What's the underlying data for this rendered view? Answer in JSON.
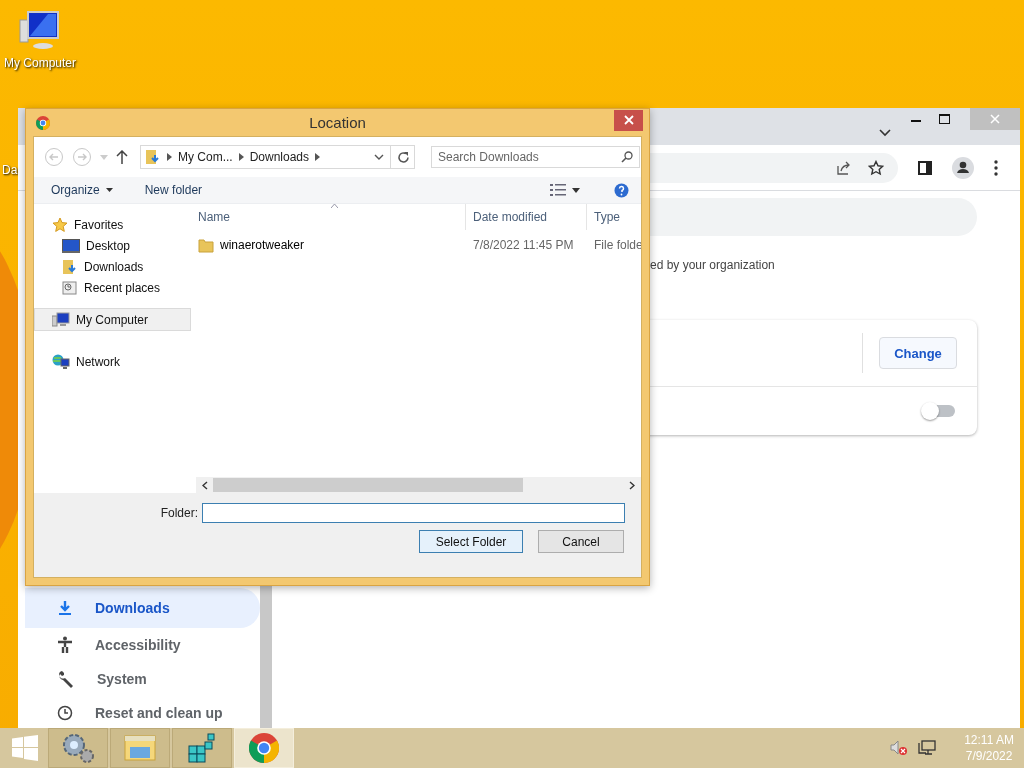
{
  "desktop": {
    "icon_label": "My Computer",
    "cut_label": "Da"
  },
  "browser": {
    "nav": [
      {
        "label": "Downloads",
        "kind": "download",
        "selected": true
      },
      {
        "label": "Accessibility",
        "kind": "accessibility",
        "selected": false
      },
      {
        "label": "System",
        "kind": "wrench",
        "selected": false
      },
      {
        "label": "Reset and clean up",
        "kind": "reset",
        "selected": false
      }
    ],
    "notice": "ed by your organization",
    "change_button": "Change",
    "toggle": {
      "on": false
    }
  },
  "dialog": {
    "title": "Location",
    "breadcrumb": [
      "My Com...",
      "Downloads"
    ],
    "search": {
      "placeholder": "Search Downloads"
    },
    "organize": "Organize",
    "new_folder": "New folder",
    "nav": [
      {
        "label": "Favorites",
        "kind": "star",
        "selected": false,
        "children": [
          {
            "label": "Desktop",
            "kind": "desktop",
            "selected": false
          },
          {
            "label": "Downloads",
            "kind": "downloads",
            "selected": false
          },
          {
            "label": "Recent places",
            "kind": "recent",
            "selected": false
          }
        ]
      },
      {
        "label": "My Computer",
        "kind": "computer",
        "selected": true
      },
      {
        "label": "Network",
        "kind": "network",
        "selected": false
      }
    ],
    "columns": [
      "Name",
      "Date modified",
      "Type"
    ],
    "rows": [
      {
        "name": "winaerotweaker",
        "date": "7/8/2022 11:45 PM",
        "type": "File folde"
      }
    ],
    "folder_label": "Folder:",
    "buttons": [
      "Select Folder",
      "Cancel"
    ]
  },
  "taskbar": {
    "apps": [
      {
        "kind": "gears",
        "selected": false
      },
      {
        "kind": "explorer",
        "selected": false
      },
      {
        "kind": "cubes",
        "selected": false
      },
      {
        "kind": "chrome",
        "selected": true
      }
    ],
    "clock": {
      "time": "12:11 AM",
      "date": "7/9/2022"
    }
  }
}
